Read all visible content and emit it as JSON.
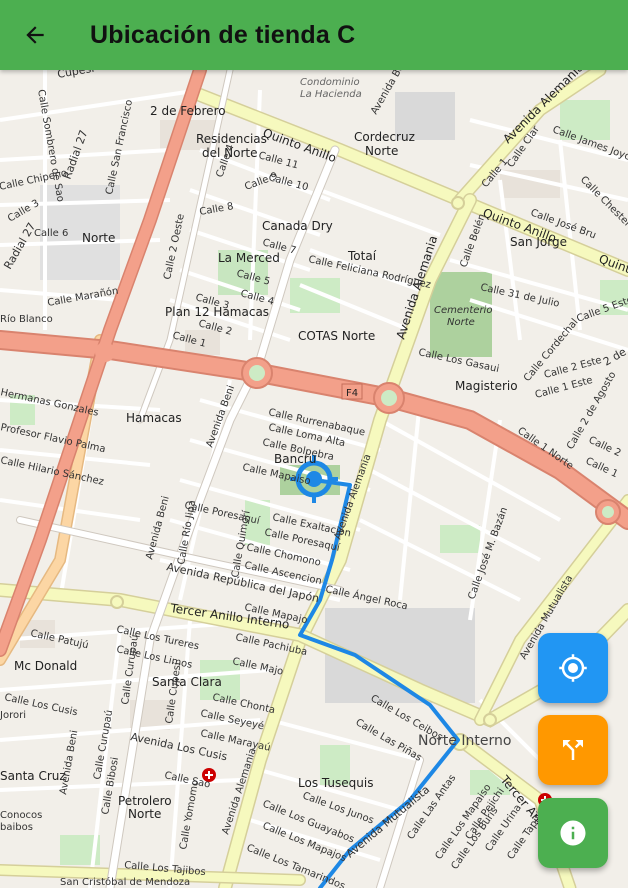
{
  "appbar": {
    "title": "Ubicación de tienda C",
    "back_icon": "arrow-back-icon"
  },
  "map": {
    "labels": {
      "cupesi": "Cupesí",
      "sombrero": "Calle Sombrero de Sao",
      "radial27a": "Radial 27",
      "radial27b": "Radial 27",
      "chipeno": "Calle Chipeno",
      "calle3": "Calle 3",
      "calle6": "Calle 6",
      "norte_w": "Norte",
      "sanfrancisco": "Calle San Francisco",
      "dosfebrero": "2 de Febrero",
      "residencias": "Residencias",
      "delnorte": "del Norte",
      "quintoanillo1": "Quinto Anillo",
      "calle11": "Calle 11",
      "calle10": "Calle 10",
      "calle9": "Calle 9",
      "calle8": "Calle 8",
      "calle4": "Calle 4",
      "canadadry": "Canada Dry",
      "calle7": "Calle 7",
      "lamerced": "La Merced",
      "calle5": "Calle 5",
      "calle4b": "Calle 4",
      "calle2oeste": "Calle 2 Oeste",
      "calle3b": "Calle 3",
      "plan12": "Plan 12 Hamacas",
      "calle2": "Calle 2",
      "calle1": "Calle 1",
      "marañon": "Calle Marañón",
      "rioblanco": "Río Blanco",
      "condominio": "Condominio",
      "lahacienda": "La Hacienda",
      "avbeni_top": "Avenida Beni",
      "cordecruz": "Cordecruz",
      "norte_c": "Norte",
      "totai": "Totaí",
      "feliciana": "Calle Feliciana Rodríguez",
      "cotas": "COTAS Norte",
      "alemania_top": "Avenida Alemania",
      "jamesjoyce": "Calle James Joyce",
      "clar": "Calle Clar",
      "calle1ne": "Calle 1",
      "quintoanillo2": "Quinto Anillo",
      "josebru": "Calle José Bru",
      "sanjorge": "San Jorge",
      "quinto_r": "Quint",
      "chester": "Calle Chester",
      "belen": "Calle Belén",
      "31julio": "Calle 31 de Julio",
      "cementerio": "Cementerio",
      "norte_cem": "Norte",
      "gasaui": "Calle Los Gasaui",
      "magisterio": "Magisterio",
      "calle5e": "Calle 5 Este",
      "calle2e": "Calle 2 Este",
      "calle1e": "Calle 1 Este",
      "cordechal": "Calle Cordechal",
      "2deagosto": "Calle 2 de Agosto",
      "2de": "2 de",
      "calle1n": "Calle 1 Norte",
      "calle2n": "Calle 2",
      "calle1b": "Calle 1",
      "f4": "F4",
      "hermanas": "Hermanas Gonzales",
      "flavio": "Profesor Flavio Palma",
      "sanchez": "Calle Hilario Sánchez",
      "hamacas": "Hamacas",
      "avbeni_mid": "Avenida Beni",
      "rurrenabaque": "Calle Rurrenabaque",
      "lomaalta": "Calle Loma Alta",
      "bolpebra": "Calle Bolpebra",
      "mapaiso": "Calle Mapaiso",
      "bancru": "Bancru",
      "poresaqui": "Calle Poresaquí",
      "exaltacion": "Calle Exaltación",
      "poresaqui2": "Calle Poresaquí",
      "chomono": "Calle Chomono",
      "ascencion": "Calle Ascencion",
      "riojipa": "Calle Río Jipa",
      "quimori": "Calle Quimorí",
      "avbeni_low": "Avenida Beni",
      "alemania_mid": "Avenida Alemania",
      "republica": "Avenida República del Japón",
      "angelroca": "Calle Ángel Roca",
      "josembazan": "Calle José M. Bazán",
      "tercer1": "Tercer Anillo Interno",
      "mapajo": "Calle Mapajo",
      "patuju": "Calle Patujú",
      "tureres": "Calle Los Tureres",
      "limos": "Calle Los Limos",
      "pachiuba": "Calle Pachiuba",
      "majo": "Calle Majo",
      "mcdonald": "Mc Donald",
      "curupau": "Calle Curupaú",
      "santaclara": "Santa Clara",
      "chonta": "Calle Chonta",
      "loscusis": "Calle Los Cusis",
      "cupesi2": "Calle Cupesí",
      "seyeyé": "Calle Seyeyé",
      "maraytu": "Calle Marayaú",
      "jorori": "Jorori",
      "avloscusis": "Avenida Los Cusis",
      "ceibos": "Calle Los Ceibos",
      "pinas": "Calle Las Piñas",
      "norteinterno": "Norte Interno",
      "mutualista1": "Avenida Mutualista",
      "santacruz": "Santa Cruz",
      "avbeni_bot": "Avenida Beni",
      "curupau2": "Calle Curupaú",
      "calle_sa": "Calle Sao",
      "petrolero": "Petrolero",
      "norte_pet": "Norte",
      "bibosi": "Calle Bibosi",
      "tusequis": "Los Tusequis",
      "junos": "Calle Los Junos",
      "guayabos": "Calle Los Guayabos",
      "mapajos": "Calle Los Mapajos",
      "tamarindos": "Calle Los Tamarindos",
      "yomomo": "Calle Yomomo",
      "alemania_bot": "Avenida Alemania",
      "mutualista2": "Avenida Mutualista",
      "antas": "Calle Las Antas",
      "tajibos": "Calle Los Tajibos",
      "cristobal": "San Cristóbal de Mendoza",
      "tercer2": "Tercer Anillo",
      "pejichi": "Calle Pejichi",
      "urina": "Calle Urina",
      "tapiti": "Calle Tapití",
      "mutualista_r": "Avenida Mutualista",
      "rio": "rio",
      "mapaiso2": "Calle Los Mapaiso",
      "buries": "Calle Los Burís",
      "tuquis": "Calle Los Tuquis",
      "conocos": "Conocos",
      "baibos": "baibos"
    }
  },
  "fabs": {
    "locate_icon": "my-location-icon",
    "route_icon": "directions-fork-icon",
    "info_icon": "info-icon"
  },
  "colors": {
    "appbar": "#4caf50",
    "route": "#2196f3",
    "primary_road": "#f3a08a",
    "secondary_road": "#f6f9be",
    "fab_locate": "#2196f3",
    "fab_route": "#ff9800",
    "fab_info": "#4caf50"
  }
}
